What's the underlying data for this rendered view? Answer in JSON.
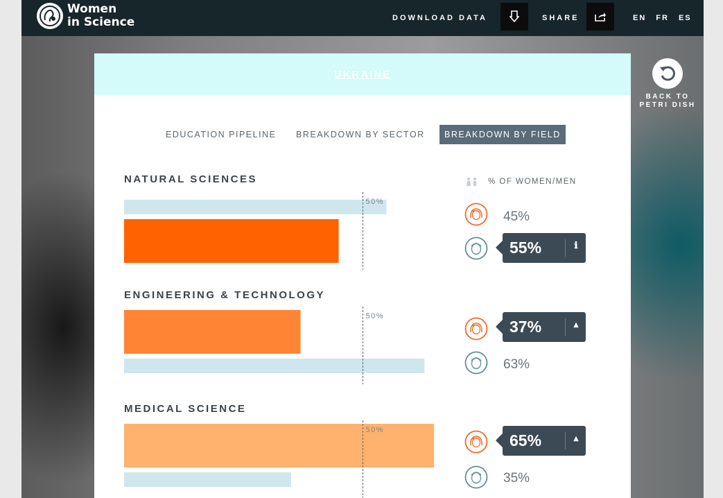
{
  "header": {
    "logo_line1": "Women",
    "logo_line2": "in Science",
    "download_label": "DOWNLOAD DATA",
    "share_label": "SHARE",
    "languages": [
      "EN",
      "FR",
      "ES"
    ],
    "active_language": "EN"
  },
  "back": {
    "line1": "BACK TO",
    "line2": "PETRI DISH"
  },
  "country": "UKRAINE",
  "tabs": [
    "EDUCATION PIPELINE",
    "BREAKDOWN BY SECTOR",
    "BREAKDOWN BY FIELD"
  ],
  "active_tab": "BREAKDOWN BY FIELD",
  "legend_label": "% OF WOMEN/MEN",
  "fifty_label": "50%",
  "colors": {
    "men_bar": "#cfe6ec",
    "natural_women": "#ff6200",
    "engineering_women": "#ff8433",
    "medical_women": "#ffb26e",
    "woman_face": "#f26a2a",
    "man_face": "#5f8f9a"
  },
  "sections": [
    {
      "title": "NATURAL SCIENCES",
      "women_pct": "45%",
      "men_pct": "55%",
      "highlight": "men"
    },
    {
      "title": "ENGINEERING & TECHNOLOGY",
      "women_pct": "37%",
      "men_pct": "63%",
      "highlight": "women"
    },
    {
      "title": "MEDICAL SCIENCE",
      "women_pct": "65%",
      "men_pct": "35%",
      "highlight": "women"
    }
  ],
  "chart_data": {
    "type": "bar",
    "categories": [
      "NATURAL SCIENCES",
      "ENGINEERING & TECHNOLOGY",
      "MEDICAL SCIENCE"
    ],
    "series": [
      {
        "name": "Women",
        "values": [
          45,
          37,
          65
        ]
      },
      {
        "name": "Men",
        "values": [
          55,
          63,
          35
        ]
      }
    ],
    "reference_line": 50,
    "ylim": [
      0,
      100
    ]
  }
}
